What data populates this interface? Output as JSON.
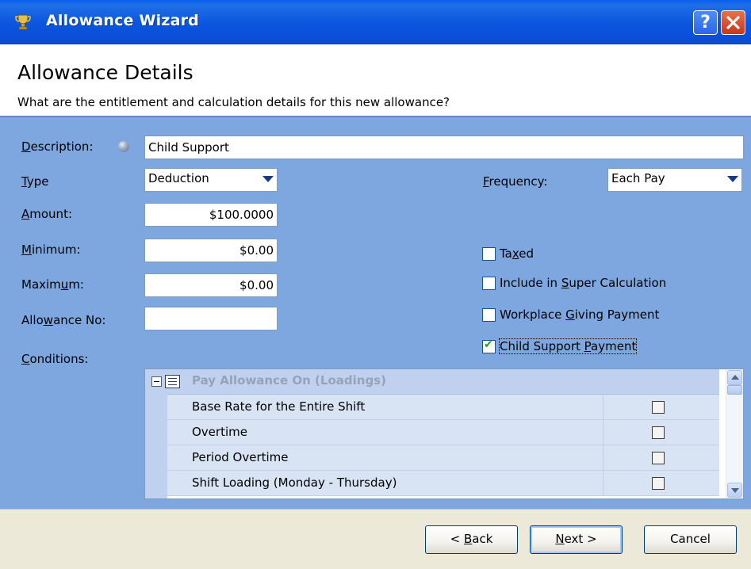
{
  "window": {
    "title": "Allowance Wizard",
    "help_label": "?",
    "icons": {
      "app": "trophy-icon",
      "help": "help-icon",
      "close": "close-icon"
    }
  },
  "header": {
    "title": "Allowance Details",
    "subtitle": "What are the entitlement and calculation details for this new allowance?"
  },
  "form": {
    "description": {
      "label_pre": "",
      "label_u": "D",
      "label_post": "escription:",
      "value": "Child Support"
    },
    "type": {
      "label_pre": "",
      "label_u": "T",
      "label_post": "ype",
      "value": "Deduction"
    },
    "frequency": {
      "label_pre": "",
      "label_u": "F",
      "label_post": "requency:",
      "value": "Each Pay"
    },
    "amount": {
      "label_pre": "",
      "label_u": "A",
      "label_post": "mount:",
      "value": "$100.0000"
    },
    "minimum": {
      "label_pre": "",
      "label_u": "M",
      "label_post": "inimum:",
      "value": "$0.00"
    },
    "maximum": {
      "label_pre": "Maxim",
      "label_u": "u",
      "label_post": "m:",
      "value": "$0.00"
    },
    "allowance_no": {
      "label_pre": "Allo",
      "label_u": "w",
      "label_post": "ance No:",
      "value": ""
    },
    "conditions": {
      "label_pre": "",
      "label_u": "C",
      "label_post": "onditions:"
    }
  },
  "checkboxes": [
    {
      "pre": "Ta",
      "u": "x",
      "post": "ed",
      "checked": false
    },
    {
      "pre": "Include in ",
      "u": "S",
      "post": "uper Calculation",
      "checked": false
    },
    {
      "pre": "Workplace ",
      "u": "G",
      "post": "iving Payment",
      "checked": false
    },
    {
      "pre": "Child Support ",
      "u": "P",
      "post": "ayment",
      "checked": true
    }
  ],
  "conditions_grid": {
    "group_title": "Pay Allowance On (Loadings)",
    "rows": [
      {
        "label": "Base Rate for the Entire Shift",
        "checked": false
      },
      {
        "label": "Overtime",
        "checked": false
      },
      {
        "label": "Period Overtime",
        "checked": false
      },
      {
        "label": "Shift Loading (Monday - Thursday)",
        "checked": false
      }
    ]
  },
  "footer": {
    "back": {
      "pre": "< ",
      "u": "B",
      "post": "ack"
    },
    "next": {
      "pre": "",
      "u": "N",
      "post": "ext >"
    },
    "cancel": "Cancel"
  },
  "colors": {
    "titlebar": "#0a55df",
    "panel": "#7ea6df",
    "footer": "#ece9d8",
    "group_header": "#bfd1ee",
    "row": "#d8e3f4"
  }
}
